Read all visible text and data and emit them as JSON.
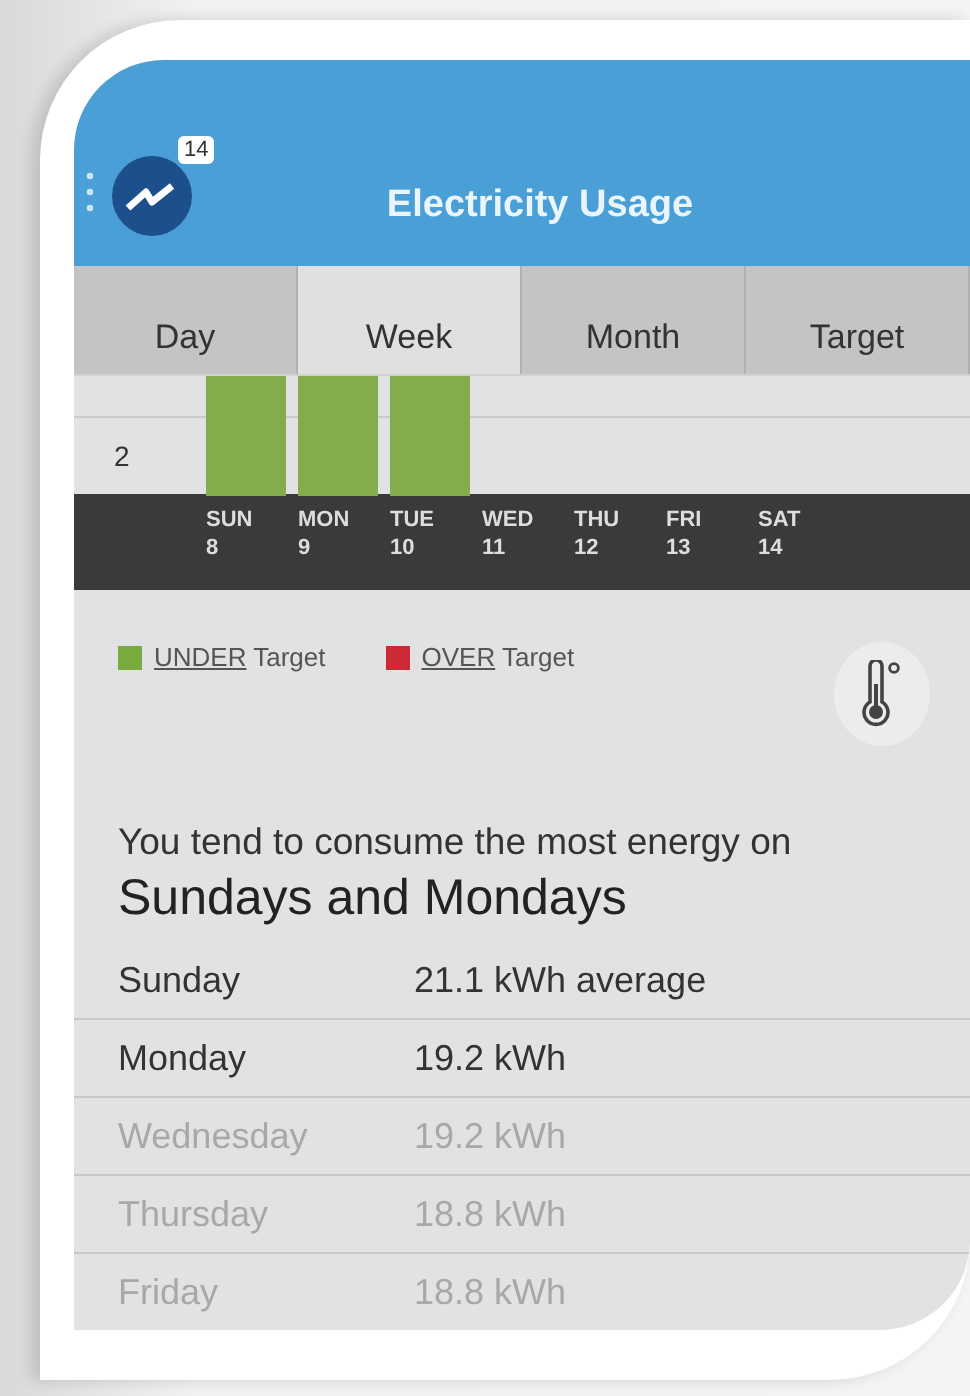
{
  "header": {
    "title": "Electricity Usage",
    "notification_count": "14"
  },
  "tabs": [
    {
      "label": "Day",
      "selected": false
    },
    {
      "label": "Week",
      "selected": true
    },
    {
      "label": "Month",
      "selected": false
    },
    {
      "label": "Target",
      "selected": false
    }
  ],
  "chart": {
    "y_label": "2",
    "days": [
      {
        "day": "SUN",
        "date": "8",
        "kind": "under"
      },
      {
        "day": "MON",
        "date": "9",
        "kind": "under"
      },
      {
        "day": "TUE",
        "date": "10",
        "kind": "under"
      },
      {
        "day": "WED",
        "date": "11",
        "kind": "none"
      },
      {
        "day": "THU",
        "date": "12",
        "kind": "none"
      },
      {
        "day": "FRI",
        "date": "13",
        "kind": "none"
      },
      {
        "day": "SAT",
        "date": "14",
        "kind": "none"
      }
    ]
  },
  "legend": [
    {
      "underlined": "UNDER",
      "label": "Target",
      "color": "#7aab3f"
    },
    {
      "underlined": "OVER",
      "label": "Target",
      "color": "#cc2b36"
    }
  ],
  "insight": {
    "text": "You tend to consume the most energy on",
    "highlight": "Sundays and Mondays"
  },
  "rows": [
    {
      "day": "Sunday",
      "value": "21.1 kWh average",
      "dimmed": false
    },
    {
      "day": "Monday",
      "value": "19.2 kWh",
      "dimmed": false
    },
    {
      "day": "Wednesday",
      "value": "19.2 kWh",
      "dimmed": true
    },
    {
      "day": "Thursday",
      "value": "18.8 kWh",
      "dimmed": true
    },
    {
      "day": "Friday",
      "value": "18.8 kWh",
      "dimmed": true
    }
  ]
}
